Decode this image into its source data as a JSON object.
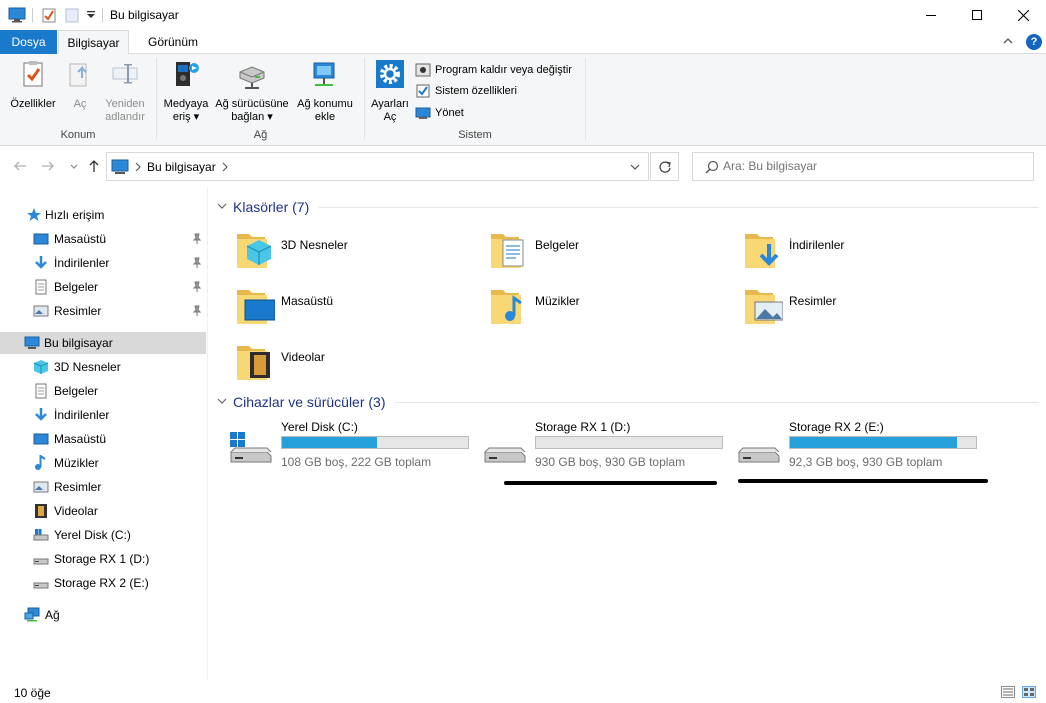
{
  "window": {
    "title": "Bu bilgisayar"
  },
  "tabs": {
    "file": "Dosya",
    "computer": "Bilgisayar",
    "view": "Görünüm"
  },
  "ribbon": {
    "properties": "Özellikler",
    "open": "Aç",
    "rename_line1": "Yeniden",
    "rename_line2": "adlandır",
    "group_location": "Konum",
    "media_line1": "Medyaya",
    "media_line2": "eriş ▾",
    "map_drive_line1": "Ağ sürücüsüne",
    "map_drive_line2": "bağlan ▾",
    "add_network_line1": "Ağ konumu",
    "add_network_line2": "ekle",
    "group_network": "Ağ",
    "settings_line1": "Ayarları",
    "settings_line2": "Aç",
    "uninstall": "Program kaldır veya değiştir",
    "system_props": "Sistem özellikleri",
    "manage": "Yönet",
    "group_system": "Sistem"
  },
  "address": {
    "path": "Bu bilgisayar",
    "search_placeholder": "Ara: Bu bilgisayar"
  },
  "nav": {
    "quick_access": "Hızlı erişim",
    "quick_items": [
      "Masaüstü",
      "İndirilenler",
      "Belgeler",
      "Resimler"
    ],
    "this_pc": "Bu bilgisayar",
    "pc_items": [
      "3D Nesneler",
      "Belgeler",
      "İndirilenler",
      "Masaüstü",
      "Müzikler",
      "Resimler",
      "Videolar",
      "Yerel Disk (C:)",
      "Storage RX 1 (D:)",
      "Storage RX 2 (E:)"
    ],
    "network": "Ağ"
  },
  "content": {
    "folders_header": "Klasörler (7)",
    "folders": [
      "3D Nesneler",
      "Belgeler",
      "İndirilenler",
      "Masaüstü",
      "Müzikler",
      "Resimler",
      "Videolar"
    ],
    "devices_header": "Cihazlar ve sürücüler (3)",
    "drives": [
      {
        "name": "Yerel Disk (C:)",
        "info": "108 GB boş, 222 GB toplam",
        "used_fraction": 0.51
      },
      {
        "name": "Storage RX 1 (D:)",
        "info": "930 GB boş, 930 GB toplam",
        "used_fraction": 0.0
      },
      {
        "name": "Storage RX 2 (E:)",
        "info": "92,3 GB boş, 930 GB toplam",
        "used_fraction": 0.9
      }
    ]
  },
  "status": {
    "item_count": "10 öğe"
  },
  "colors": {
    "accent": "#1979ca",
    "drive_bar": "#26a0da",
    "folder": "#f8d775",
    "header_text": "#1e3287"
  }
}
